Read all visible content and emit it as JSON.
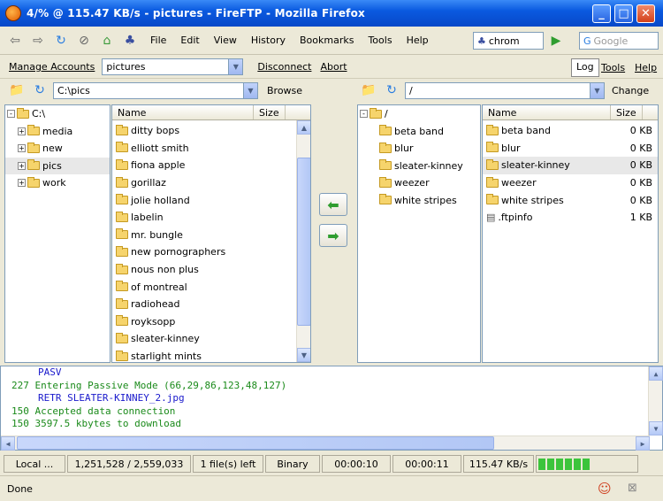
{
  "window": {
    "title": "4/% @ 115.47 KB/s - pictures - FireFTP - Mozilla Firefox"
  },
  "menu": [
    "File",
    "Edit",
    "View",
    "History",
    "Bookmarks",
    "Tools",
    "Help"
  ],
  "toolbar": {
    "url_fragment": "chrom",
    "search_placeholder": "Google"
  },
  "accounts": {
    "manage_label": "Manage Accounts",
    "account_value": "pictures",
    "disconnect_label": "Disconnect",
    "abort_label": "Abort",
    "tabs": [
      "Log",
      "Tools",
      "Help"
    ]
  },
  "local": {
    "path": "C:\\pics",
    "browse_label": "Browse",
    "tree": [
      {
        "label": "C:\\",
        "expander": "-"
      },
      {
        "label": "media",
        "expander": "+"
      },
      {
        "label": "new",
        "expander": "+"
      },
      {
        "label": "pics",
        "expander": "+"
      },
      {
        "label": "work",
        "expander": "+"
      }
    ],
    "columns": {
      "name": "Name",
      "size": "Size"
    },
    "files": [
      "ditty bops",
      "elliott smith",
      "fiona apple",
      "gorillaz",
      "jolie holland",
      "labelin",
      "mr. bungle",
      "new pornographers",
      "nous non plus",
      "of montreal",
      "radiohead",
      "royksopp",
      "sleater-kinney",
      "starlight mints"
    ]
  },
  "remote": {
    "path": "/",
    "change_label": "Change",
    "tree": [
      "/",
      "beta band",
      "blur",
      "sleater-kinney",
      "weezer",
      "white stripes"
    ],
    "columns": {
      "name": "Name",
      "size": "Size"
    },
    "files": [
      {
        "name": "beta band",
        "size": "0 KB"
      },
      {
        "name": "blur",
        "size": "0 KB"
      },
      {
        "name": "sleater-kinney",
        "size": "0 KB"
      },
      {
        "name": "weezer",
        "size": "0 KB"
      },
      {
        "name": "white stripes",
        "size": "0 KB"
      },
      {
        "name": ".ftpinfo",
        "size": "1 KB"
      }
    ]
  },
  "log": [
    {
      "text": "PASV",
      "color": "#1a1acc",
      "indent": true
    },
    {
      "text": "227 Entering Passive Mode (66,29,86,123,48,127)",
      "color": "#1a8a1a",
      "indent": false
    },
    {
      "text": "RETR SLEATER-KINNEY_2.jpg",
      "color": "#1a1acc",
      "indent": true
    },
    {
      "text": "150 Accepted data connection",
      "color": "#1a8a1a",
      "indent": false
    },
    {
      "text": "150 3597.5 kbytes to download",
      "color": "#1a8a1a",
      "indent": false
    }
  ],
  "status": {
    "mode": "Local ...",
    "bytes": "1,251,528 / 2,559,033",
    "files": "1 file(s) left",
    "type": "Binary",
    "elapsed": "00:00:10",
    "remaining": "00:00:11",
    "speed": "115.47 KB/s",
    "progress_blocks": 6
  },
  "bottom": {
    "status": "Done"
  },
  "colors": {
    "accent": "#0a5ae0",
    "progress": "#3cc43c"
  }
}
